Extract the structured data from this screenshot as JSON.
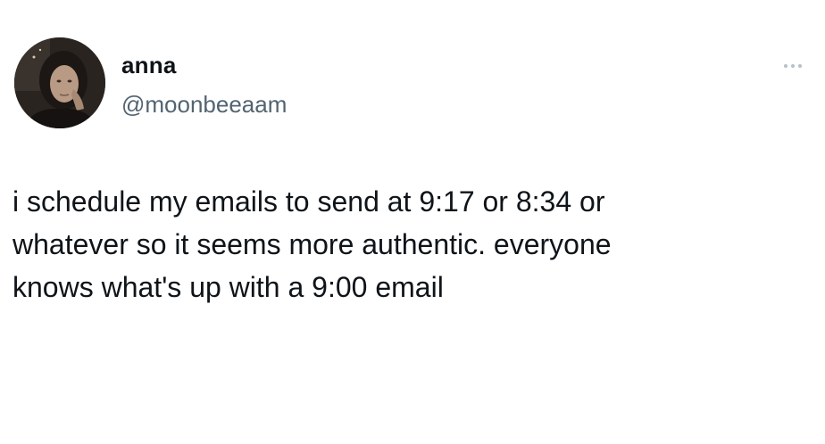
{
  "author": {
    "display_name": "anna",
    "handle": "@moonbeeaam"
  },
  "tweet": {
    "lines": [
      "i schedule my emails to send at 9:17 or 8:34 or",
      "whatever so it seems more authentic. everyone",
      "knows what's up with a 9:00 email"
    ]
  },
  "icons": {
    "more": "more-options-icon"
  },
  "colors": {
    "text_primary": "#0f1419",
    "text_secondary": "#536471",
    "background": "#ffffff"
  }
}
